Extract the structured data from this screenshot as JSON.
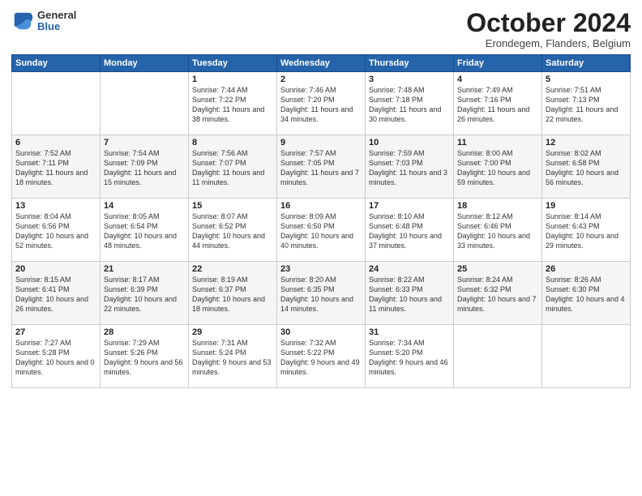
{
  "logo": {
    "general": "General",
    "blue": "Blue"
  },
  "title": "October 2024",
  "location": "Erondegem, Flanders, Belgium",
  "days_of_week": [
    "Sunday",
    "Monday",
    "Tuesday",
    "Wednesday",
    "Thursday",
    "Friday",
    "Saturday"
  ],
  "weeks": [
    [
      {
        "day": "",
        "info": ""
      },
      {
        "day": "",
        "info": ""
      },
      {
        "day": "1",
        "info": "Sunrise: 7:44 AM\nSunset: 7:22 PM\nDaylight: 11 hours and 38 minutes."
      },
      {
        "day": "2",
        "info": "Sunrise: 7:46 AM\nSunset: 7:20 PM\nDaylight: 11 hours and 34 minutes."
      },
      {
        "day": "3",
        "info": "Sunrise: 7:48 AM\nSunset: 7:18 PM\nDaylight: 11 hours and 30 minutes."
      },
      {
        "day": "4",
        "info": "Sunrise: 7:49 AM\nSunset: 7:16 PM\nDaylight: 11 hours and 26 minutes."
      },
      {
        "day": "5",
        "info": "Sunrise: 7:51 AM\nSunset: 7:13 PM\nDaylight: 11 hours and 22 minutes."
      }
    ],
    [
      {
        "day": "6",
        "info": "Sunrise: 7:52 AM\nSunset: 7:11 PM\nDaylight: 11 hours and 18 minutes."
      },
      {
        "day": "7",
        "info": "Sunrise: 7:54 AM\nSunset: 7:09 PM\nDaylight: 11 hours and 15 minutes."
      },
      {
        "day": "8",
        "info": "Sunrise: 7:56 AM\nSunset: 7:07 PM\nDaylight: 11 hours and 11 minutes."
      },
      {
        "day": "9",
        "info": "Sunrise: 7:57 AM\nSunset: 7:05 PM\nDaylight: 11 hours and 7 minutes."
      },
      {
        "day": "10",
        "info": "Sunrise: 7:59 AM\nSunset: 7:03 PM\nDaylight: 11 hours and 3 minutes."
      },
      {
        "day": "11",
        "info": "Sunrise: 8:00 AM\nSunset: 7:00 PM\nDaylight: 10 hours and 59 minutes."
      },
      {
        "day": "12",
        "info": "Sunrise: 8:02 AM\nSunset: 6:58 PM\nDaylight: 10 hours and 56 minutes."
      }
    ],
    [
      {
        "day": "13",
        "info": "Sunrise: 8:04 AM\nSunset: 6:56 PM\nDaylight: 10 hours and 52 minutes."
      },
      {
        "day": "14",
        "info": "Sunrise: 8:05 AM\nSunset: 6:54 PM\nDaylight: 10 hours and 48 minutes."
      },
      {
        "day": "15",
        "info": "Sunrise: 8:07 AM\nSunset: 6:52 PM\nDaylight: 10 hours and 44 minutes."
      },
      {
        "day": "16",
        "info": "Sunrise: 8:09 AM\nSunset: 6:50 PM\nDaylight: 10 hours and 40 minutes."
      },
      {
        "day": "17",
        "info": "Sunrise: 8:10 AM\nSunset: 6:48 PM\nDaylight: 10 hours and 37 minutes."
      },
      {
        "day": "18",
        "info": "Sunrise: 8:12 AM\nSunset: 6:46 PM\nDaylight: 10 hours and 33 minutes."
      },
      {
        "day": "19",
        "info": "Sunrise: 8:14 AM\nSunset: 6:43 PM\nDaylight: 10 hours and 29 minutes."
      }
    ],
    [
      {
        "day": "20",
        "info": "Sunrise: 8:15 AM\nSunset: 6:41 PM\nDaylight: 10 hours and 26 minutes."
      },
      {
        "day": "21",
        "info": "Sunrise: 8:17 AM\nSunset: 6:39 PM\nDaylight: 10 hours and 22 minutes."
      },
      {
        "day": "22",
        "info": "Sunrise: 8:19 AM\nSunset: 6:37 PM\nDaylight: 10 hours and 18 minutes."
      },
      {
        "day": "23",
        "info": "Sunrise: 8:20 AM\nSunset: 6:35 PM\nDaylight: 10 hours and 14 minutes."
      },
      {
        "day": "24",
        "info": "Sunrise: 8:22 AM\nSunset: 6:33 PM\nDaylight: 10 hours and 11 minutes."
      },
      {
        "day": "25",
        "info": "Sunrise: 8:24 AM\nSunset: 6:32 PM\nDaylight: 10 hours and 7 minutes."
      },
      {
        "day": "26",
        "info": "Sunrise: 8:26 AM\nSunset: 6:30 PM\nDaylight: 10 hours and 4 minutes."
      }
    ],
    [
      {
        "day": "27",
        "info": "Sunrise: 7:27 AM\nSunset: 5:28 PM\nDaylight: 10 hours and 0 minutes."
      },
      {
        "day": "28",
        "info": "Sunrise: 7:29 AM\nSunset: 5:26 PM\nDaylight: 9 hours and 56 minutes."
      },
      {
        "day": "29",
        "info": "Sunrise: 7:31 AM\nSunset: 5:24 PM\nDaylight: 9 hours and 53 minutes."
      },
      {
        "day": "30",
        "info": "Sunrise: 7:32 AM\nSunset: 5:22 PM\nDaylight: 9 hours and 49 minutes."
      },
      {
        "day": "31",
        "info": "Sunrise: 7:34 AM\nSunset: 5:20 PM\nDaylight: 9 hours and 46 minutes."
      },
      {
        "day": "",
        "info": ""
      },
      {
        "day": "",
        "info": ""
      }
    ]
  ]
}
